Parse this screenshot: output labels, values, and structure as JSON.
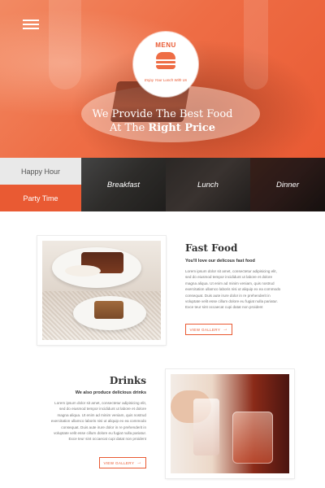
{
  "logo": {
    "title": "MENU",
    "tagline": "Enjoy Your Lunch With Us"
  },
  "hero": {
    "line1": "We Provide The Best Food",
    "line2_prefix": "At The ",
    "line2_bold": "Right Price"
  },
  "categories": {
    "left": [
      "Happy Hour",
      "Party Time"
    ],
    "photos": [
      "Breakfast",
      "Lunch",
      "Dinner"
    ]
  },
  "sections": [
    {
      "title": "Fast Food",
      "subtitle": "You'll love our delicous fast food",
      "body": "Lorem ipsum dolor sit amet, consectetur adipisicing elit, sed do eiusmod tempor incididunt ut labore et dolore magna aliqua. Ut enim ad minim veniam, quis nostrud exercitation ullamco laboris nisi ut aliquip ex ea commodo consequat. Duis aute irure dolor in re prehenderit in voluptate velit esse cillum dolore eu fugiat nulla pariatur. Exce teur sint occaecat cupi datat non proident",
      "button": "VIEW GALLERY"
    },
    {
      "title": "Drinks",
      "subtitle": "We also produce delicious drinks",
      "body": "Lorem ipsum dolor sit amet, consectetur adipisicing elit, sed do eiusmod tempor incididunt ut labore et dolore magna aliqua. Ut enim ad minim veniam, quis nostrud exercitation ullamco laboris nisi ut aliquip ex ea commodo consequat. Duis aute irure dolor in re prehenderit in voluptate velit esse cillum dolore eu fugiat nulla pariatur. Exce teur sint occaecat cupi datat non proident",
      "button": "VIEW GALLERY"
    }
  ],
  "icons": {
    "menu": "hamburger-menu-icon",
    "logo": "burger-icon",
    "button_arrow": "arrow-right-icon"
  },
  "colors": {
    "accent": "#e95a33",
    "light_gray": "#e9e9e9"
  }
}
